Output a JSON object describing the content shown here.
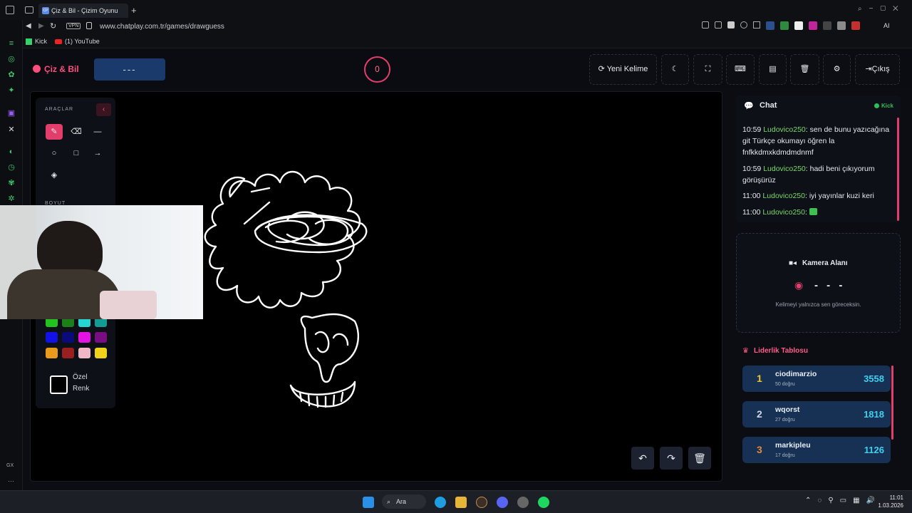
{
  "browser": {
    "tab_title": "Çiz & Bil - Çizim Oyunu",
    "tab_favicon_text": "CP",
    "vpn_label": "VPN",
    "url": "www.chatplay.com.tr/games/drawguess",
    "bookmarks": [
      {
        "label": "Kick"
      },
      {
        "label": "(1) YouTube"
      }
    ],
    "ai_label": "AI"
  },
  "app": {
    "brand": "Çiz & Bil",
    "word_display": "---",
    "timer": "0",
    "buttons": {
      "new_word": "Yeni Kelime",
      "exit": "Çıkış"
    },
    "header_icons": [
      "moon-icon",
      "fullscreen-icon",
      "keyboard-icon",
      "archive-icon",
      "trash-icon",
      "gear-icon"
    ]
  },
  "tools": {
    "title": "ARAÇLAR",
    "size_title": "BOYUT",
    "custom_color_label": "Özel Renk",
    "palette": [
      "#22c31e",
      "#1d7f1a",
      "#25d6d0",
      "#139c94",
      "#1212e8",
      "#0a0a7a",
      "#e314e3",
      "#7a0c84",
      "#e89a1a",
      "#9a2020",
      "#f0b8c6",
      "#f0d21a"
    ]
  },
  "chat": {
    "title": "Chat",
    "live_label": "Kick",
    "messages": [
      {
        "time": "10:59",
        "user": "Ludovico250",
        "text": ": sen de bunu yazıcağına git Türkçe okumayı öğren la fnfkkdmxkdmdmdnmf"
      },
      {
        "time": "10:59",
        "user": "Ludovico250",
        "text": ": hadi beni çıkıyorum görüşürüz"
      },
      {
        "time": "11:00",
        "user": "Ludovico250",
        "text": ": iyi yayınlar kuzi keri"
      },
      {
        "time": "11:00",
        "user": "Ludovico250",
        "text": ":"
      }
    ]
  },
  "camera": {
    "title": "Kamera Alanı",
    "word": "- - -",
    "note": "Kelimeyi yalnızca sen göreceksin."
  },
  "leaderboard": {
    "title": "Liderlik Tablosu",
    "rows": [
      {
        "rank": "1",
        "name": "ciodimarzio",
        "sub": "50 doğru",
        "score": "3558",
        "rank_color": "#f2c230"
      },
      {
        "rank": "2",
        "name": "wqorst",
        "sub": "27 doğru",
        "score": "1818",
        "rank_color": "#cfd6e2"
      },
      {
        "rank": "3",
        "name": "markipleu",
        "sub": "17 doğru",
        "score": "1126",
        "rank_color": "#e08a3a"
      }
    ]
  },
  "taskbar": {
    "search_label": "Ara",
    "time": "11:01",
    "date": "1.03.2026",
    "left_label": "GX"
  }
}
